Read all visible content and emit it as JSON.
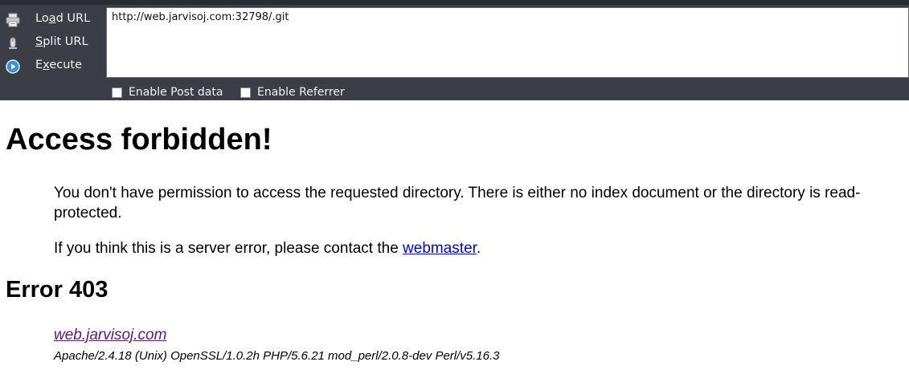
{
  "toolbar": {
    "load_url": {
      "pre": "Lo",
      "key": "a",
      "post": "d URL",
      "icon": "printer-icon"
    },
    "split_url": {
      "pre": "",
      "key": "S",
      "post": "plit URL",
      "icon": "mouse-icon"
    },
    "execute": {
      "pre": "E",
      "key": "x",
      "post": "ecute",
      "icon": "play-circle-icon"
    },
    "url_value": "http://web.jarvisoj.com:32798/.git",
    "enable_post_label": "Enable Post data",
    "enable_referrer_label": "Enable Referrer",
    "background_color": "#3b3e47"
  },
  "page": {
    "title": "Access forbidden!",
    "paragraph1": "You don't have permission to access the requested directory. There is either no index document or the directory is read-protected.",
    "paragraph2_prefix": "If you think this is a server error, please contact the ",
    "paragraph2_link": "webmaster",
    "paragraph2_suffix": ".",
    "error_heading": "Error 403",
    "address_link": "web.jarvisoj.com",
    "server_signature": "Apache/2.4.18 (Unix) OpenSSL/1.0.2h PHP/5.6.21 mod_perl/2.0.8-dev Perl/v5.16.3",
    "link_color": "#0000ee",
    "visited_link_color": "#551a8b"
  }
}
